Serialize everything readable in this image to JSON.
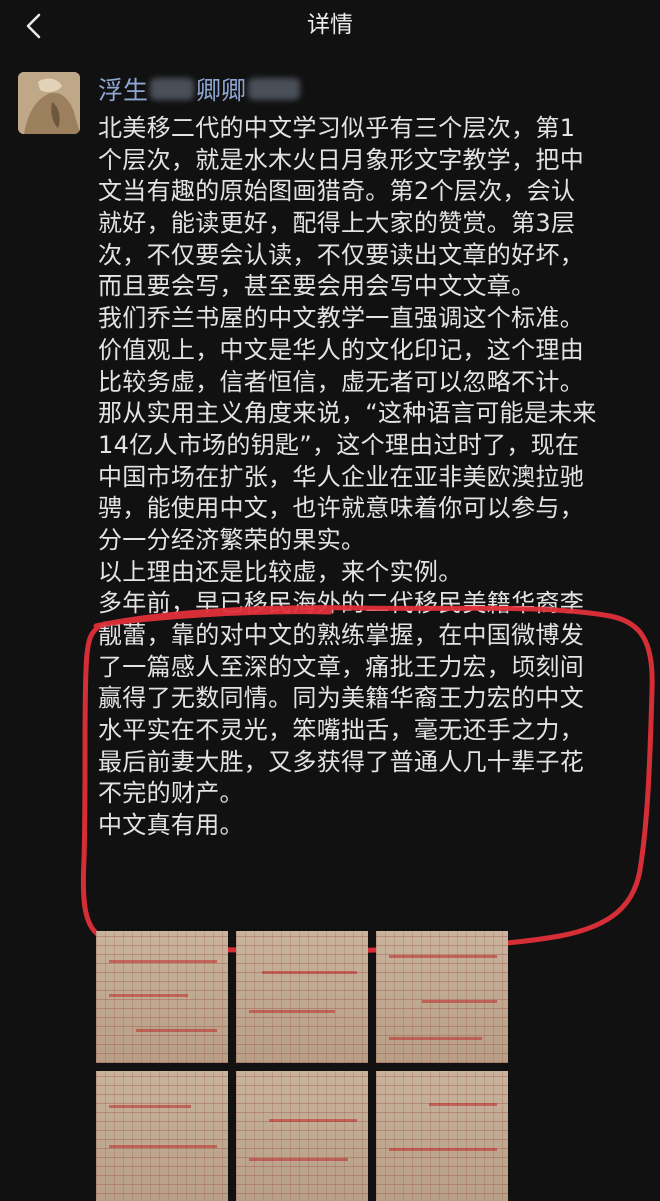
{
  "header": {
    "title": "详情"
  },
  "post": {
    "author_visible_1": "浮生",
    "author_visible_2": "卿卿",
    "body_lines": [
      "北美移二代的中文学习似乎有三个层次，第1",
      "个层次，就是水木火日月象形文字教学，把中",
      "文当有趣的原始图画猎奇。第2个层次，会认",
      "就好，能读更好，配得上大家的赞赏。第3层",
      "次，不仅要会认读，不仅要读出文章的好坏，",
      "而且要会写，甚至要会用会写中文文章。",
      "我们乔兰书屋的中文教学一直强调这个标准。",
      "价值观上，中文是华人的文化印记，这个理由",
      "比较务虚，信者恒信，虚无者可以忽略不计。",
      "那从实用主义角度来说，“这种语言可能是未来",
      "14亿人市场的钥匙”，这个理由过时了，现在",
      "中国市场在扩张，华人企业在亚非美欧澳拉驰",
      "骋，能使用中文，也许就意味着你可以参与，",
      "分一分经济繁荣的果实。",
      "以上理由还是比较虚，来个实例。",
      "多年前，早已移民海外的二代移民美籍华裔李",
      "靓蕾，靠的对中文的熟练掌握，在中国微博发",
      "了一篇感人至深的文章，痛批王力宏，顷刻间",
      "赢得了无数同情。同为美籍华裔王力宏的中文",
      "水平实在不灵光，笨嘴拙舌，毫无还手之力，",
      "最后前妻大胜，又多获得了普通人几十辈子花",
      "不完的财产。",
      "中文真有用。"
    ]
  },
  "colors": {
    "background": "#111111",
    "author": "#8fa6d3",
    "annotation": "#e0303a"
  }
}
